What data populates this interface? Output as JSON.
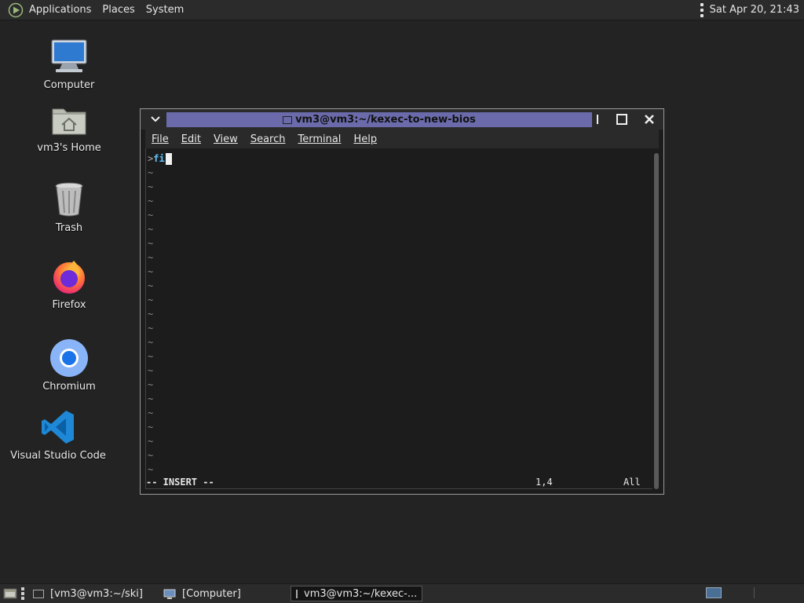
{
  "top_panel": {
    "menus": [
      "Applications",
      "Places",
      "System"
    ],
    "clock": "Sat Apr 20, 21:43"
  },
  "desktop": {
    "icons": [
      {
        "label": "Computer",
        "icon": "computer-icon"
      },
      {
        "label": "vm3's Home",
        "icon": "home-folder-icon"
      },
      {
        "label": "Trash",
        "icon": "trash-icon"
      },
      {
        "label": "Firefox",
        "icon": "firefox-icon"
      },
      {
        "label": "Chromium",
        "icon": "chromium-icon"
      },
      {
        "label": "Visual Studio Code",
        "icon": "vscode-icon"
      }
    ]
  },
  "window": {
    "title": "vm3@vm3:~/kexec-to-new-bios",
    "menu": [
      "File",
      "Edit",
      "View",
      "Search",
      "Terminal",
      "Help"
    ],
    "prompt_char": ">",
    "typed_text": "fi",
    "tilde_char": "~",
    "status_mode": "-- INSERT --",
    "status_position": "1,4",
    "status_percent": "All"
  },
  "taskbar": {
    "tasks": [
      {
        "label": "[vm3@vm3:~/ski]",
        "active": false
      },
      {
        "label": "[Computer]",
        "active": false
      },
      {
        "label": "vm3@vm3:~/kexec-...",
        "active": true
      }
    ]
  },
  "colors": {
    "title_bar_active": "#6b6bab",
    "desktop_bg": "#232323",
    "panel_bg": "#2b2b2b",
    "command_text": "#5ec4ff"
  }
}
